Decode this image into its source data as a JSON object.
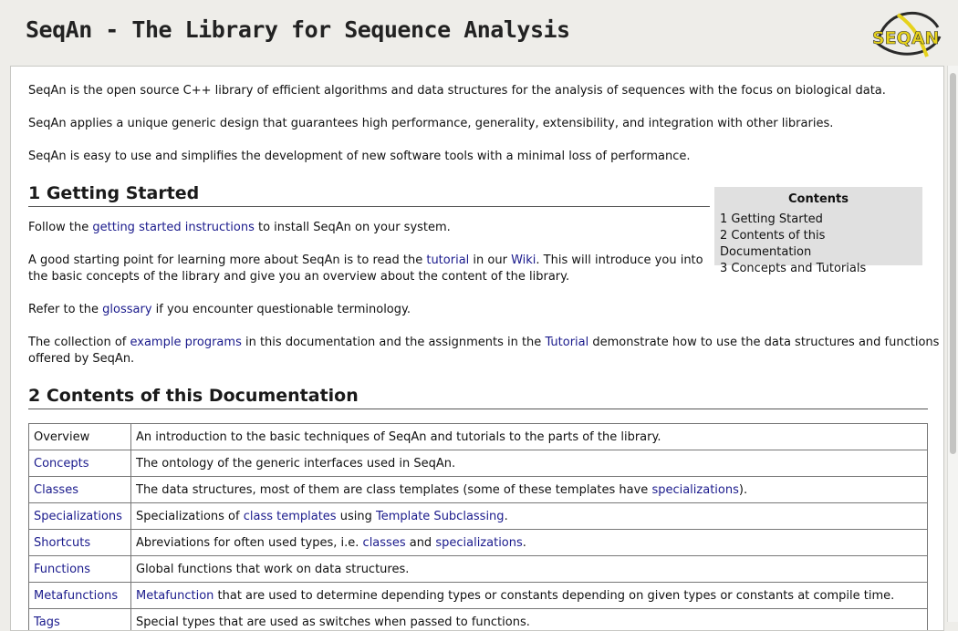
{
  "header": {
    "title": "SeqAn - The Library for Sequence Analysis",
    "logo_text": "SEQAN",
    "colors": {
      "logo_yellow": "#e6d21c",
      "logo_dark": "#2a2a2a"
    }
  },
  "intro": {
    "p1": "SeqAn is the open source C++ library of efficient algorithms and data structures for the analysis of sequences with the focus on biological data.",
    "p2": "SeqAn applies a unique generic design that guarantees high performance, generality, extensibility, and integration with other libraries.",
    "p3": "SeqAn is easy to use and simplifies the development of new software tools with a minimal loss of performance."
  },
  "toc": {
    "title": "Contents",
    "items": [
      "1 Getting Started",
      "2 Contents of this Documentation",
      "3 Concepts and Tutorials"
    ]
  },
  "getting_started": {
    "heading": "1 Getting Started",
    "p1_pre": "Follow the ",
    "p1_link": "getting started instructions",
    "p1_post": " to install SeqAn on your system.",
    "p2_a": "A good starting point for learning more about SeqAn is to read the ",
    "p2_link1": "tutorial",
    "p2_b": " in our ",
    "p2_link2": "Wiki",
    "p2_c": ". This will introduce you into",
    "p2_line2": "the basic concepts of the library and give you an overview about the content of the library.",
    "p3_pre": "Refer to the ",
    "p3_link": "glossary",
    "p3_post": " if you encounter questionable terminology.",
    "p4_a": "The collection of ",
    "p4_link1": "example programs",
    "p4_b": " in this documentation and the assignments in the ",
    "p4_link2": "Tutorial",
    "p4_c": " demonstrate how to use the data structures and functions",
    "p4_line2": "offered by SeqAn."
  },
  "contents": {
    "heading": "2 Contents of this Documentation",
    "rows": [
      {
        "name": "Overview",
        "desc": [
          {
            "t": "An introduction to the basic techniques of SeqAn and tutorials to the parts of the library."
          }
        ]
      },
      {
        "name": "Concepts",
        "desc": [
          {
            "t": "The ontology of the generic interfaces used in SeqAn."
          }
        ]
      },
      {
        "name": "Classes",
        "desc": [
          {
            "t": "The data structures, most of them are class templates (some of these templates have "
          },
          {
            "t": "specializations",
            "link": true
          },
          {
            "t": ")."
          }
        ]
      },
      {
        "name": "Specializations",
        "desc": [
          {
            "t": "Specializations of "
          },
          {
            "t": "class templates",
            "link": true
          },
          {
            "t": " using "
          },
          {
            "t": "Template Subclassing",
            "link": true
          },
          {
            "t": "."
          }
        ]
      },
      {
        "name": "Shortcuts",
        "desc": [
          {
            "t": "Abreviations for often used types, i.e. "
          },
          {
            "t": "classes",
            "link": true
          },
          {
            "t": " and "
          },
          {
            "t": "specializations",
            "link": true
          },
          {
            "t": "."
          }
        ]
      },
      {
        "name": "Functions",
        "desc": [
          {
            "t": "Global functions that work on data structures."
          }
        ]
      },
      {
        "name": "Metafunctions",
        "desc": [
          {
            "t": "Metafunction",
            "link": true
          },
          {
            "t": " that are used to determine depending types or constants depending on given types or constants at compile time."
          }
        ]
      },
      {
        "name": "Tags",
        "desc": [
          {
            "t": "Special types that are used as switches when passed to functions."
          }
        ]
      }
    ]
  }
}
